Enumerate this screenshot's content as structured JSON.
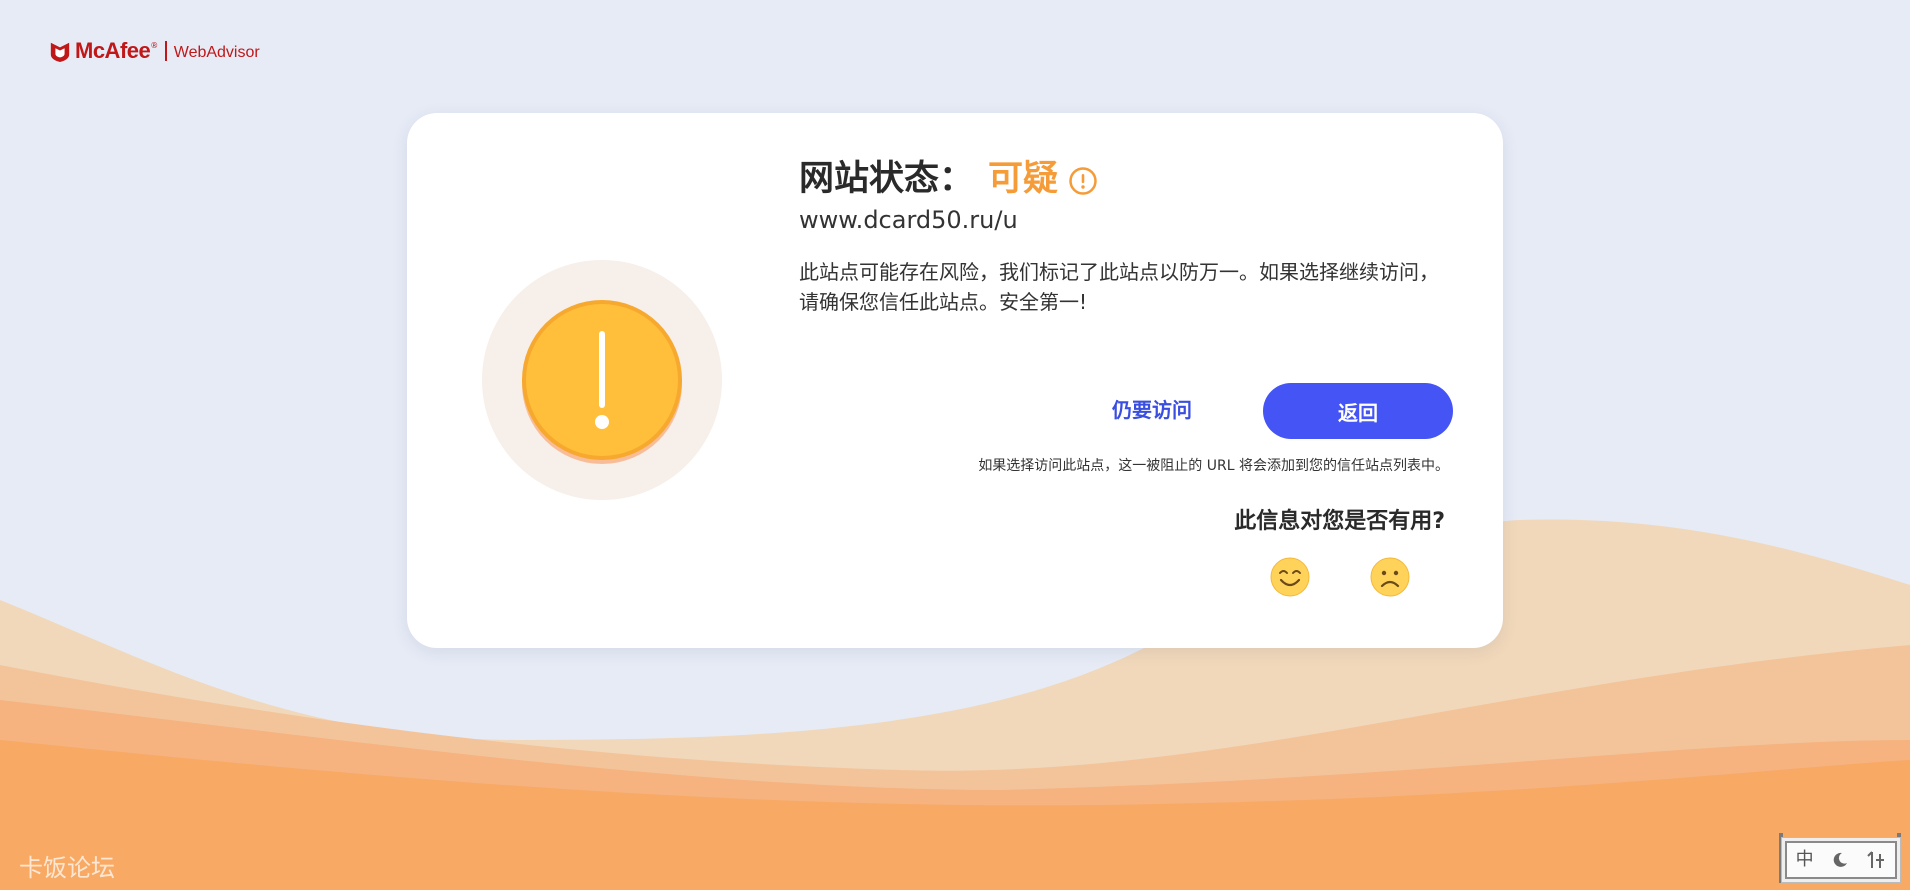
{
  "header": {
    "brand": "McAfee",
    "trademark": "®",
    "product": "WebAdvisor",
    "logo_icon": "mcafee-shield-icon",
    "brand_color": "#c01818"
  },
  "card": {
    "title_label": "网站状态：",
    "status": "可疑",
    "status_icon": "info-circle-icon",
    "status_color": "#f59b37",
    "hero_icon": "warning-exclamation-icon",
    "url": "www.dcard50.ru/u",
    "description": "此站点可能存在风险，我们标记了此站点以防万一。如果选择继续访问，请确保您信任此站点。安全第一!",
    "visit_anyway_label": "仍要访问",
    "back_label": "返回",
    "accent_color": "#4454f5",
    "note": "如果选择访问此站点，这一被阻止的 URL 将会添加到您的信任站点列表中。",
    "feedback_question": "此信息对您是否有用?",
    "feedback_options": [
      "smiley-happy-icon",
      "smiley-sad-icon"
    ]
  },
  "watermark": "卡饭论坛",
  "ime_toolbar": {
    "mode": "中",
    "punctuation_icon": "half-moon-icon",
    "soft_keyboard_icon": "tools-icon"
  }
}
